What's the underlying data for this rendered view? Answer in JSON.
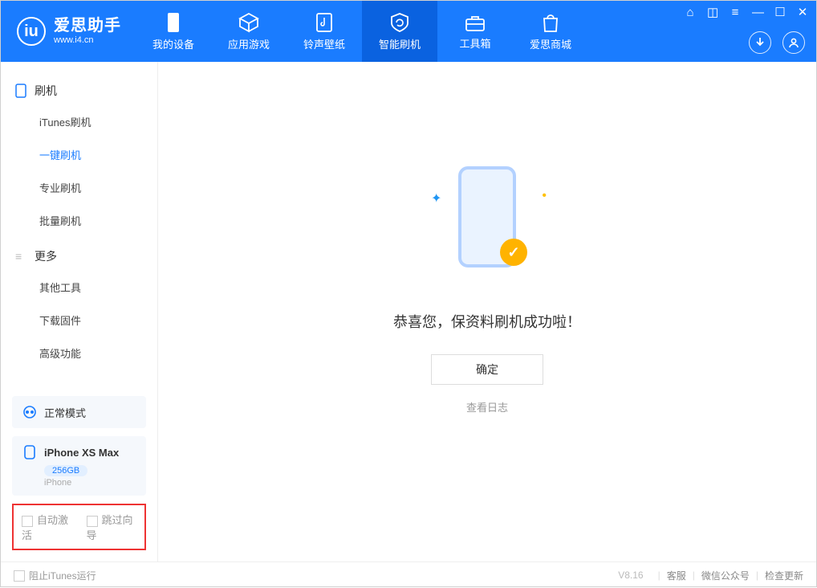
{
  "app": {
    "title": "爱思助手",
    "subtitle": "www.i4.cn"
  },
  "tabs": {
    "device": "我的设备",
    "apps": "应用游戏",
    "ring": "铃声壁纸",
    "flash": "智能刷机",
    "tools": "工具箱",
    "store": "爱思商城"
  },
  "sidebar": {
    "flash_section": "刷机",
    "items": {
      "itunes": "iTunes刷机",
      "oneclick": "一键刷机",
      "pro": "专业刷机",
      "batch": "批量刷机"
    },
    "more_section": "更多",
    "more": {
      "other": "其他工具",
      "firmware": "下载固件",
      "advanced": "高级功能"
    },
    "mode": "正常模式",
    "device_name": "iPhone XS Max",
    "device_storage": "256GB",
    "device_type": "iPhone",
    "auto_activate": "自动激活",
    "skip_guide": "跳过向导"
  },
  "main": {
    "success_msg": "恭喜您，保资料刷机成功啦！",
    "ok_btn": "确定",
    "view_log": "查看日志"
  },
  "footer": {
    "block_itunes": "阻止iTunes运行",
    "version": "V8.16",
    "support": "客服",
    "wechat": "微信公众号",
    "update": "检查更新"
  }
}
